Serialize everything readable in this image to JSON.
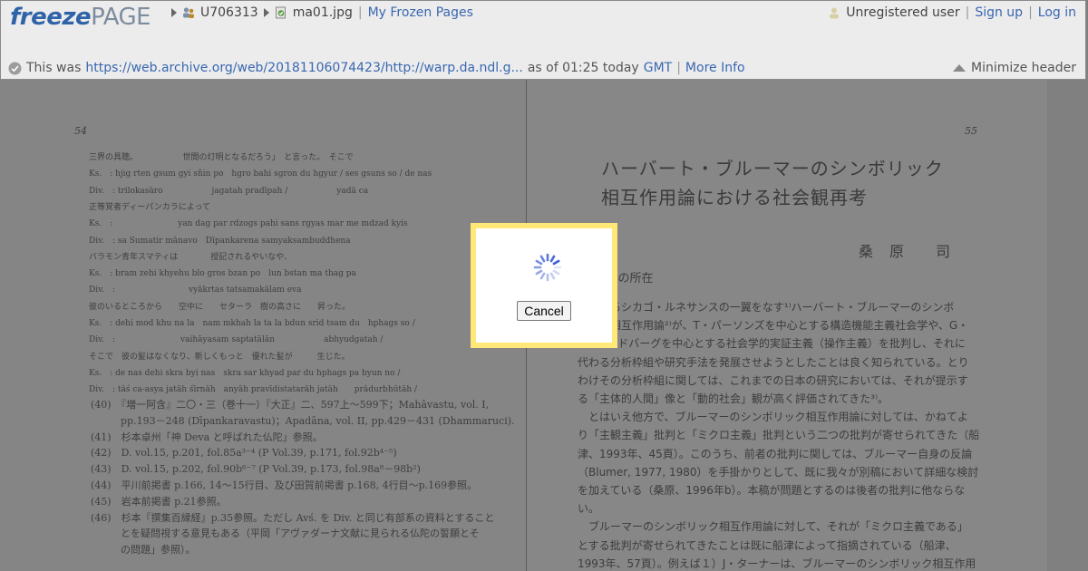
{
  "header": {
    "logo_part1": "freeze",
    "logo_part2": "PAGE",
    "crumb_user": "U706313",
    "crumb_file": "ma01.jpg",
    "my_frozen_pages": "My Frozen Pages",
    "separator": "|",
    "user_status": "Unregistered user",
    "sign_up": "Sign up",
    "log_in": "Log in",
    "this_was": "This was",
    "source_url": "https://web.archive.org/web/20181106074423/http://warp.da.ndl.g...",
    "as_of": "as of 01:25 today",
    "tz": "GMT",
    "more_info": "More Info",
    "minimize": "Minimize header"
  },
  "document": {
    "left_page_number": "54",
    "right_page_number": "55",
    "left_lines": [
      "三界の具聴。　　　　　　世間の灯明となるだろう」　と言った。　そこで",
      "Ks.　: hjig rten gsum gyi sñin po　hgro bahi sgron du hgyur / ses gsuns so / de nas",
      "Div.　: trilokasāro　　　　　　jagatah pradīpah /　　　　　　yadā ca",
      "正等覚者ディーパンカラによって",
      "Ks.　:　　　　　　　　yan dag par rdzogs pahi sans rgyas mar me mdzad kyis",
      "Div.　: sa Sumatir mānavo　Dīpankarena samyaksambuddhena",
      "バラモン青年スマティは　　　　授記されるやいなや、",
      "Ks.　: bram zehi khyehu blo gros bzan po　lun bstan ma thag pa",
      "Div.　:　　　　　　　　　vyākrtas tatsamakālam eva",
      "彼のいるところから　　空中に　　セターラ　樹の高さに　　昇った。",
      "Ks.　: dehi mod khu na la　nam mkhah la ta la bdun srid tsam du　hphags so /",
      "Div.　:　　　　　　　　vaihāyasam saptatālān　　　　　　abhyudgatah /",
      "そこで　彼の髪はなくなり、新しくもっと　優れた髪が　　　生じた。",
      "Ks.　: de nas dehi skra byi nas　skra sar khyad par du hphags pa byun no /",
      "Div.　: tāś ca-asya jatāh śīrnāh　anyāh pravīdistatarāh jatāh　　prādurbhūtāh /"
    ],
    "left_notes": [
      "(40)　『増一阿含』二〇・三（巻十一）『大正』二、597上～599下；Mahāvastu, vol. I,",
      "　　　pp.193－248 (Dīpankaravastu)；Apadāna, vol. II, pp.429－431 (Dhammaruci).",
      "(41)　杉本卓州「神 Deva と呼ばれた仏陀」参照。",
      "(42)　D. vol.15, p.201, fol.85a³⁻⁴ (P Vol.39, p.171, fol.92b⁴⁻⁵)",
      "(43)　D. vol.15, p.202, fol.90b⁶⁻⁷ (P Vol.39, p.173, fol.98a⁸－98b²)",
      "(44)　平川前掲書 p.166, 14～15行目、及び田賀前掲書 p.168, 4行目～p.169参照。",
      "(45)　岩本前掲書 p.21参照。",
      "(46)　杉本『撰集百縁経』p.35参照。ただし Avś. を Div. と同じ有部系の資料とすること",
      "　　　とを疑問視する意見もある（平岡「アヴァダーナ文献に見られる仏陀の誓願とそ",
      "　　　の問題」参照）。"
    ],
    "right_title_1": "ハーバート・ブルーマーのシンボリック",
    "right_title_2": "相互作用論における社会観再考",
    "right_author": "桑　原　　司",
    "right_section": "1. 問題の所在",
    "right_lines": [
      "いわゆるシカゴ・ルネサンスの一翼をなす¹⁾ハーバート・ブルーマーのシンボ",
      "リック相互作用論²⁾が、T・パーソンズを中心とする構造機能主義社会学や、G・",
      "A・ランドバーグを中心とする社会学的実証主義（操作主義）を批判し、それに",
      "代わる分析枠組や研究手法を発展させようとしたことは良く知られている。とり",
      "わけその分析枠組に関しては、これまでの日本の研究においては、それが提示す",
      "る「主体的人間」像と「動的社会」観が高く評価されてきた³⁾。",
      "　とはいえ他方で、ブルーマーのシンボリック相互作用論に対しては、かねてよ",
      "り「主観主義」批判と「ミクロ主義」批判という二つの批判が寄せられてきた（船",
      "津、1993年、45頁）。このうち、前者の批判に関しては、ブルーマー自身の反論",
      "（Blumer, 1977, 1980）を手掛かりとして、既に我々が別稿において詳細な検討",
      "を加えている（桑原、1996年b）。本稿が問題とするのは後者の批判に他ならな",
      "い。",
      "　ブルーマーのシンボリック相互作用論に対して、それが「ミクロ主義である」",
      "とする批判が寄せられてきたことは既に船津によって指摘されている（船津、",
      "1993年、57頁）。例えば１）J・ターナーは、ブルーマーのシンボリック相互作用"
    ]
  },
  "dialog": {
    "cancel_label": "Cancel",
    "border_color": "#ffe878",
    "spinner_color": "#3d5dd6"
  }
}
